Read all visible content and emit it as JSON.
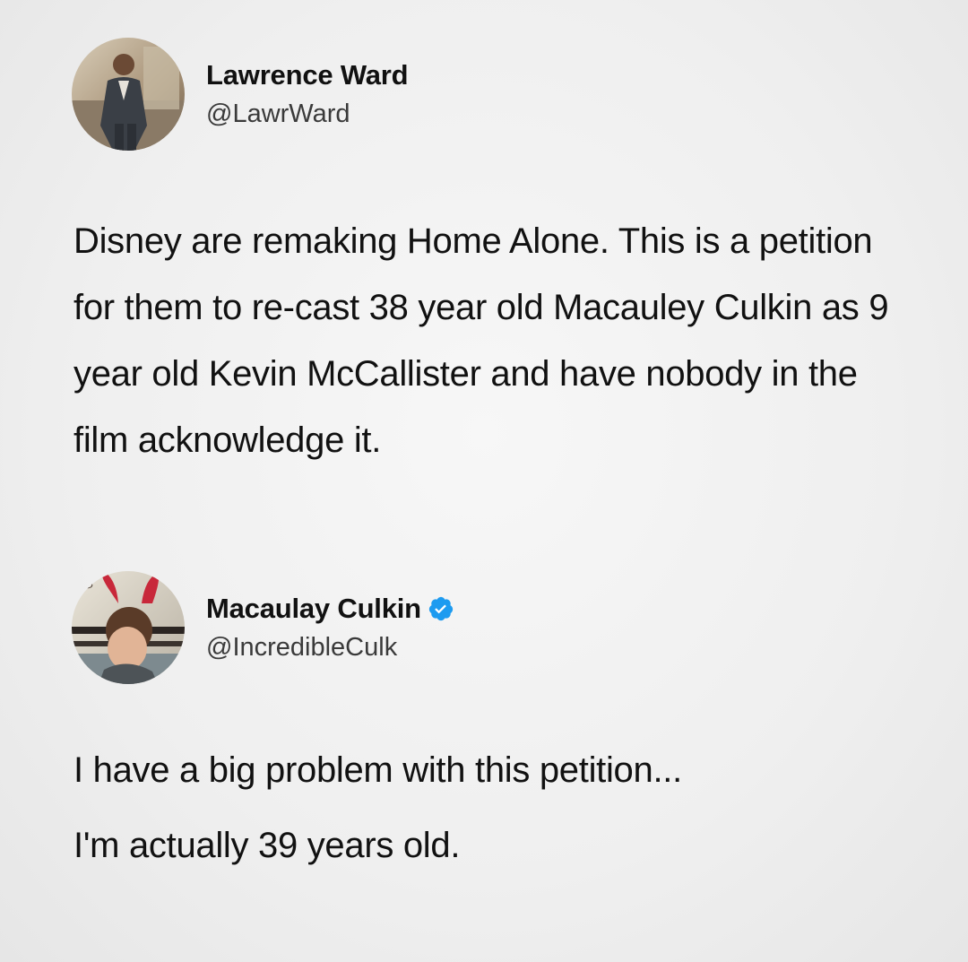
{
  "tweets": [
    {
      "display_name": "Lawrence Ward",
      "handle": "@LawrWard",
      "verified": false,
      "text": "Disney are remaking Home Alone. This is a petition for them to re-cast 38 year old Macauley Culkin as 9 year old Kevin McCallister and have nobody in the film acknowledge it."
    },
    {
      "display_name": "Macaulay Culkin",
      "handle": "@IncredibleCulk",
      "verified": true,
      "verified_color": "#1d9bf0",
      "text_lines": [
        "I have a big problem with this petition...",
        "I'm actually 39 years old."
      ]
    }
  ],
  "colors": {
    "background": "#efefef",
    "text": "#111111",
    "verified": "#1d9bf0"
  }
}
